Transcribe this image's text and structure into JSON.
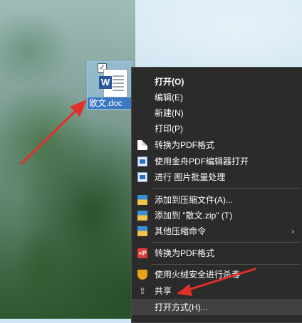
{
  "desktop": {
    "file": {
      "name": "散文.doc",
      "checkbox": "✓",
      "badge": "W"
    }
  },
  "context_menu": {
    "items": [
      {
        "label": "打开(O)",
        "bold": true,
        "icon": null
      },
      {
        "label": "编辑(E)",
        "icon": null
      },
      {
        "label": "新建(N)",
        "icon": null
      },
      {
        "label": "打印(P)",
        "icon": null
      },
      {
        "label": "转换为PDF格式",
        "icon": "pdf-page-icon"
      },
      {
        "label": "使用金舟PDF编辑器打开",
        "icon": "app-window-icon"
      },
      {
        "label": "进行 图片批量处理",
        "icon": "image-batch-icon"
      },
      {
        "label": "添加到压缩文件(A)...",
        "icon": "archive-icon"
      },
      {
        "label": "添加到 \"散文.zip\" (T)",
        "icon": "archive-icon"
      },
      {
        "label": "其他压缩命令",
        "icon": "archive-icon",
        "submenu_arrow": "›"
      },
      {
        "label": "转换为PDF格式",
        "icon": "red-p-icon",
        "glyph": "+P"
      },
      {
        "label": "使用火绒安全进行杀毒",
        "icon": "shield-icon"
      },
      {
        "label": "共享",
        "icon": "share-icon",
        "glyph": "⇪"
      },
      {
        "label": "打开方式(H)...",
        "icon": null
      }
    ]
  },
  "colors": {
    "menu_bg": "#2b2b2b",
    "menu_hover": "#414141",
    "annotation_arrow": "#e0302a",
    "selection": "#99c9ef"
  }
}
